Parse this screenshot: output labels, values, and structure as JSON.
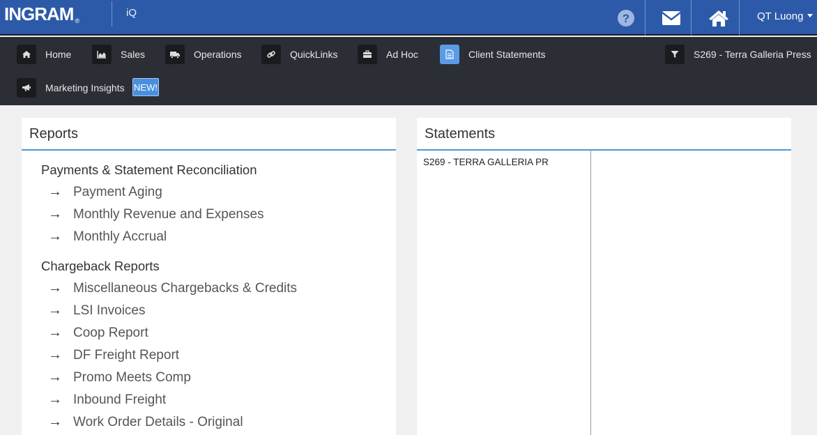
{
  "header": {
    "logo": "INGRAM",
    "logo_mark": "®",
    "app_name": "iQ",
    "user_name": "QT Luong",
    "icons": [
      "help-icon",
      "mail-icon",
      "home-icon"
    ],
    "bg_color": "#2d5aa8"
  },
  "nav": {
    "items": [
      {
        "label": "Home",
        "icon": "home-icon"
      },
      {
        "label": "Sales",
        "icon": "area-chart-icon"
      },
      {
        "label": "Operations",
        "icon": "truck-icon"
      },
      {
        "label": "QuickLinks",
        "icon": "link-icon"
      },
      {
        "label": "Ad Hoc",
        "icon": "briefcase-icon"
      },
      {
        "label": "Client Statements",
        "icon": "document-icon",
        "active": true
      },
      {
        "label": "S269 - Terra Galleria Press",
        "icon": "filter-icon"
      },
      {
        "label": "Marketing Insights",
        "icon": "megaphone-icon"
      }
    ],
    "new_badge": "NEW!",
    "active_color": "#5b9be6"
  },
  "reports": {
    "title": "Reports",
    "groups": [
      {
        "title": "Payments & Statement Reconciliation",
        "items": [
          "Payment Aging",
          "Monthly Revenue and Expenses",
          "Monthly Accrual"
        ]
      },
      {
        "title": "Chargeback Reports",
        "items": [
          "Miscellaneous Chargebacks & Credits",
          "LSI Invoices",
          "Coop Report",
          "DF Freight Report",
          "Promo Meets Comp",
          "Inbound Freight",
          "Work Order Details - Original"
        ]
      }
    ],
    "arrow": "→"
  },
  "statements": {
    "title": "Statements",
    "rows": [
      "S269 - TERRA GALLERIA PR"
    ]
  }
}
